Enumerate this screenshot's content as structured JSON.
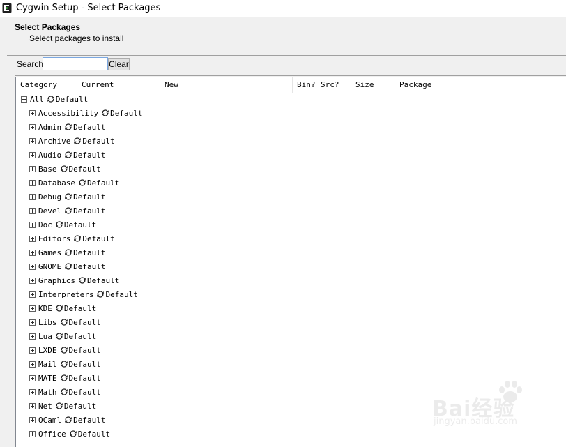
{
  "window": {
    "title": "Cygwin Setup - Select Packages"
  },
  "header": {
    "title": "Select Packages",
    "subtitle": "Select packages to install"
  },
  "search": {
    "label": "Search",
    "value": "",
    "placeholder": "",
    "clear_label": "Clear"
  },
  "columns": [
    "Category",
    "Current",
    "New",
    "Bin?",
    "Src?",
    "Size",
    "Package"
  ],
  "root": {
    "label": "All",
    "action": "Default",
    "expanded": true
  },
  "categories": [
    {
      "label": "Accessibility",
      "action": "Default"
    },
    {
      "label": "Admin",
      "action": "Default"
    },
    {
      "label": "Archive",
      "action": "Default"
    },
    {
      "label": "Audio",
      "action": "Default"
    },
    {
      "label": "Base",
      "action": "Default"
    },
    {
      "label": "Database",
      "action": "Default"
    },
    {
      "label": "Debug",
      "action": "Default"
    },
    {
      "label": "Devel",
      "action": "Default"
    },
    {
      "label": "Doc",
      "action": "Default"
    },
    {
      "label": "Editors",
      "action": "Default"
    },
    {
      "label": "Games",
      "action": "Default"
    },
    {
      "label": "GNOME",
      "action": "Default"
    },
    {
      "label": "Graphics",
      "action": "Default"
    },
    {
      "label": "Interpreters",
      "action": "Default"
    },
    {
      "label": "KDE",
      "action": "Default"
    },
    {
      "label": "Libs",
      "action": "Default"
    },
    {
      "label": "Lua",
      "action": "Default"
    },
    {
      "label": "LXDE",
      "action": "Default"
    },
    {
      "label": "Mail",
      "action": "Default"
    },
    {
      "label": "MATE",
      "action": "Default"
    },
    {
      "label": "Math",
      "action": "Default"
    },
    {
      "label": "Net",
      "action": "Default"
    },
    {
      "label": "OCaml",
      "action": "Default"
    },
    {
      "label": "Office",
      "action": "Default"
    }
  ],
  "icons": {
    "app": "cygwin-logo-icon",
    "expand": "plus-box-icon",
    "collapse": "minus-box-icon",
    "action": "cycle-arrows-icon"
  },
  "colors": {
    "background": "#f0f0f0",
    "list_background": "#ffffff",
    "input_border": "#7aa7e0",
    "logo_green": "#2a8a2a"
  },
  "watermark": {
    "brand": "Bai经验",
    "url": "jingyan.baidu.com"
  }
}
